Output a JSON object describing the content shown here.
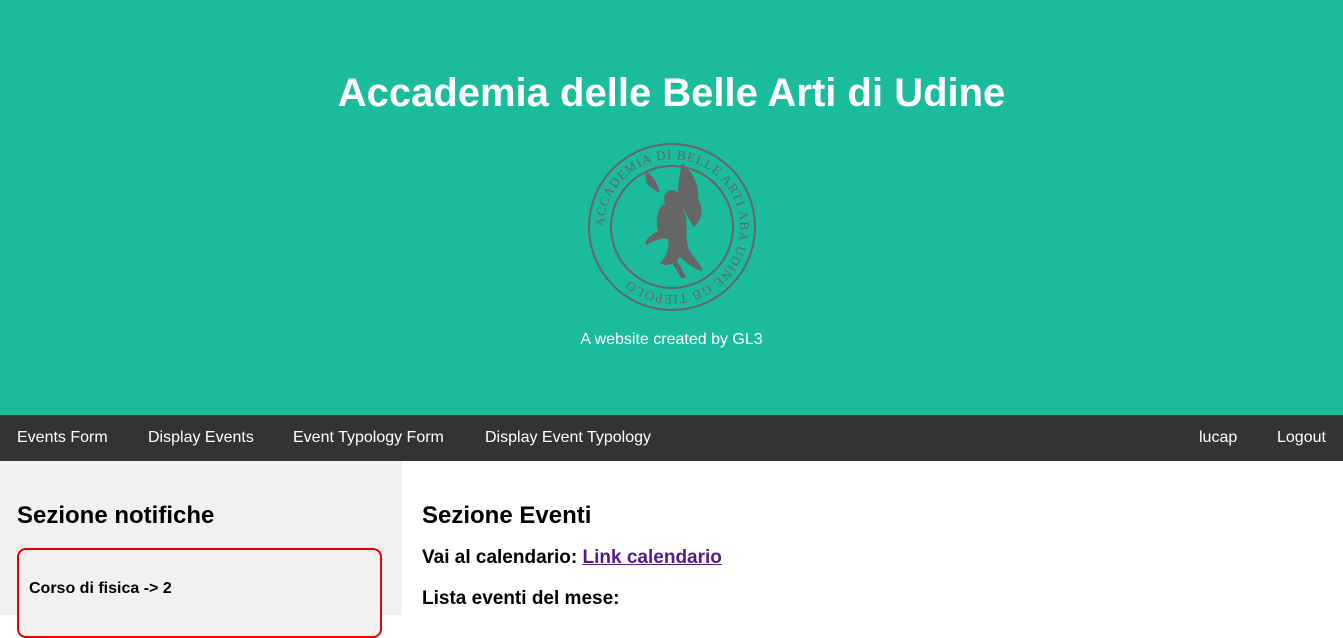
{
  "header": {
    "title": "Accademia delle Belle Arti di Udine",
    "tagline": "A website created by GL3",
    "logo": {
      "ring_text_top": "ABA",
      "ring_text_left": "ACCADEMIA DI BELLE ARTI",
      "ring_text_right": "UDINE GB TIEPOLO",
      "color": "#666666"
    },
    "background_color": "#1abc9c"
  },
  "navbar": {
    "background_color": "#333333",
    "left_items": [
      {
        "label": "Events Form"
      },
      {
        "label": "Display Events"
      },
      {
        "label": "Event Typology Form"
      },
      {
        "label": "Display Event Typology"
      }
    ],
    "right_items": [
      {
        "label": "lucap"
      },
      {
        "label": "Logout"
      }
    ]
  },
  "sidebar": {
    "title": "Sezione notifiche",
    "notifications": [
      {
        "text": "Corso di fisica -> 2"
      }
    ],
    "border_color": "#e60000"
  },
  "main": {
    "title": "Sezione Eventi",
    "calendar_prefix": "Vai al calendario:",
    "calendar_link": "Link calendario",
    "list_label": "Lista eventi del mese:"
  }
}
